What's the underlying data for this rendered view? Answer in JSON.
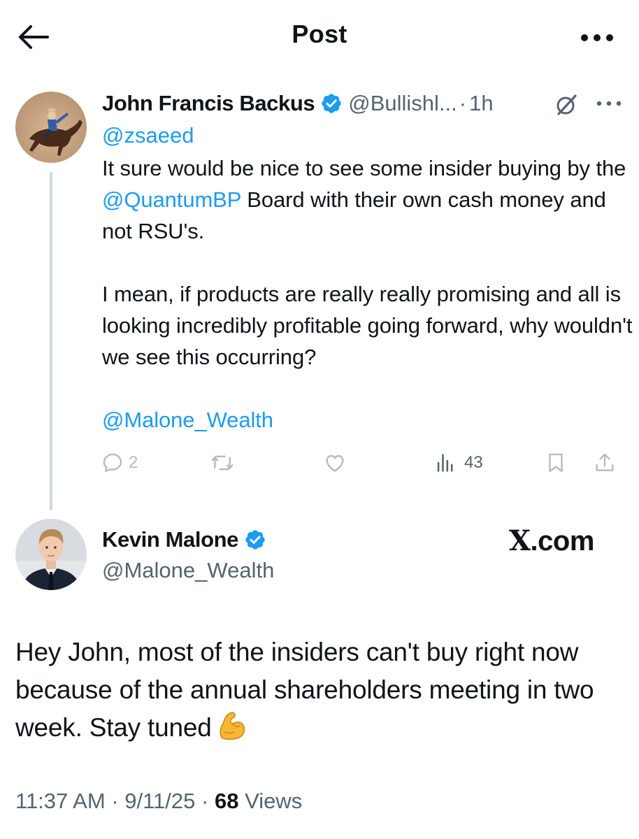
{
  "header": {
    "title": "Post",
    "back_icon": "arrow-left-icon",
    "more_icon": "more-horizontal-icon"
  },
  "parent_tweet": {
    "author_name": "John Francis Backus",
    "verified": true,
    "handle": "@Bullishl...",
    "separator": "·",
    "time": "1h",
    "reply_to": "@zsaeed",
    "text": {
      "line1_prefix": "It sure would be nice to see some insider buying by the ",
      "mention1": "@QuantumBP",
      "line1_suffix": " Board with their own cash money and not RSU's.",
      "para2": "I mean, if products are really really promising and all is looking incredibly profitable going forward, why wouldn't we see this occurring?",
      "mention2": "@Malone_Wealth"
    },
    "actions": {
      "replies": "2",
      "reposts": "",
      "likes": "",
      "views": "43"
    }
  },
  "main_tweet": {
    "author_name": "Kevin Malone",
    "verified": true,
    "handle": "@Malone_Wealth",
    "overlay_watermark": "X.com",
    "text": "Hey John, most of the insiders can't buy right now because of the annual shareholders meeting in two week. Stay tuned",
    "emoji": "flexed-biceps-emoji",
    "time": "11:37 AM",
    "date": "9/11/25",
    "separator": "·",
    "views_count": "68",
    "views_label": "Views"
  },
  "colors": {
    "link": "#1d9bf0",
    "text": "#0f1419",
    "secondary": "#536471",
    "verified": "#1d9bf0",
    "thread_line": "#cfd9de",
    "action_icon": "#b4bcc3"
  }
}
